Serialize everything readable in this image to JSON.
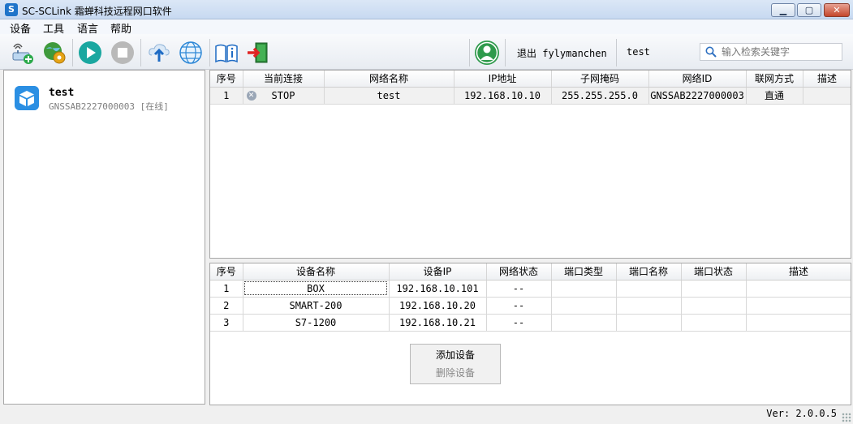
{
  "window": {
    "app_icon_letter": "S",
    "title": "SC-SCLink 霜蝉科技远程网口软件",
    "min_glyph": "▁",
    "max_glyph": "▢",
    "close_glyph": "✕"
  },
  "menu": [
    "设备",
    "工具",
    "语言",
    "帮助"
  ],
  "toolbar": {
    "icons": [
      "add-device-icon",
      "network-settings-icon",
      "start-icon",
      "stop-icon",
      "upload-icon",
      "globe-icon",
      "manual-icon",
      "exit-icon"
    ],
    "logout_label": "退出 fylymanchen",
    "user": "test",
    "search_placeholder": "输入检索关键字"
  },
  "device_list": [
    {
      "name": "test",
      "sub": "GNSSAB2227000003 [在线]"
    }
  ],
  "network_table": {
    "headers": [
      "序号",
      "当前连接",
      "网络名称",
      "IP地址",
      "子网掩码",
      "网络ID",
      "联网方式",
      "描述"
    ],
    "rows": [
      [
        "1",
        "STOP",
        "test",
        "192.168.10.10",
        "255.255.255.0",
        "GNSSAB2227000003",
        "直通",
        ""
      ]
    ]
  },
  "device_table": {
    "headers": [
      "序号",
      "设备名称",
      "设备IP",
      "网络状态",
      "端口类型",
      "端口名称",
      "端口状态",
      "描述"
    ],
    "rows": [
      [
        "1",
        "BOX",
        "192.168.10.101",
        "--",
        "",
        "",
        "",
        ""
      ],
      [
        "2",
        "SMART-200",
        "192.168.10.20",
        "--",
        "",
        "",
        "",
        ""
      ],
      [
        "3",
        "S7-1200",
        "192.168.10.21",
        "--",
        "",
        "",
        "",
        ""
      ]
    ]
  },
  "actions": {
    "add": "添加设备",
    "remove": "删除设备"
  },
  "status": {
    "version": "Ver: 2.0.0.5"
  }
}
